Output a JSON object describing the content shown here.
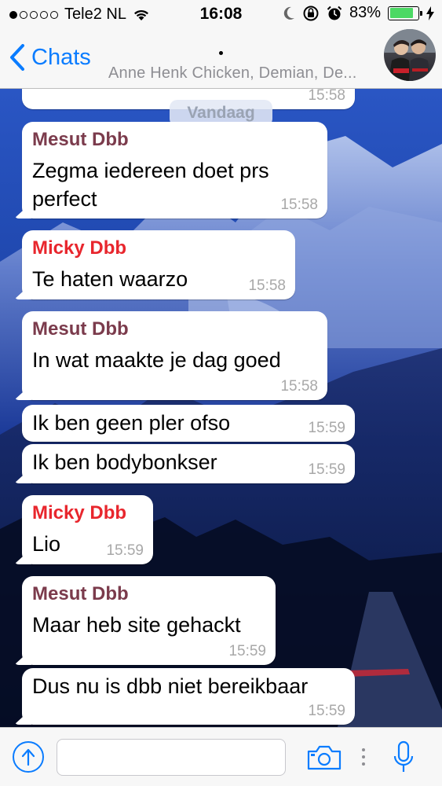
{
  "status_bar": {
    "carrier": "Tele2 NL",
    "time": "16:08",
    "battery_percent": "83%",
    "battery_level": 0.83,
    "signal_bars_filled": 1,
    "signal_bars_total": 5,
    "battery_color": "#4cd964",
    "icons": [
      "wifi-icon",
      "moon-icon",
      "orientation-lock-icon",
      "alarm-icon",
      "charging-icon"
    ]
  },
  "header": {
    "back_label": "Chats",
    "title": "",
    "subtitle": "Anne Henk Chicken, Demian, De...",
    "accent_color": "#0a7cff"
  },
  "chat": {
    "date_label": "Vandaag",
    "messages": [
      {
        "sender": "",
        "text": "",
        "time": "15:58"
      },
      {
        "sender": "Mesut Dbb",
        "sender_color": "#7b3b4c",
        "lines": [
          "Zegma iedereen doet prs",
          "perfect"
        ],
        "time": "15:58"
      },
      {
        "sender": "Micky Dbb",
        "sender_color": "#e8262d",
        "lines": [
          "Te haten waarzo"
        ],
        "time": "15:58"
      },
      {
        "sender": "Mesut Dbb",
        "sender_color": "#7b3b4c",
        "lines": [
          "In wat maakte je dag goed"
        ],
        "time": "15:58"
      },
      {
        "sender": "",
        "lines": [
          "Ik ben geen pler ofso"
        ],
        "time": "15:59"
      },
      {
        "sender": "",
        "lines": [
          "Ik ben bodybonkser"
        ],
        "time": "15:59"
      },
      {
        "sender": "Micky Dbb",
        "sender_color": "#e8262d",
        "lines": [
          "Lio"
        ],
        "time": "15:59"
      },
      {
        "sender": "Mesut Dbb",
        "sender_color": "#7b3b4c",
        "lines": [
          "Maar heb site gehackt"
        ],
        "time": "15:59"
      },
      {
        "sender": "",
        "lines": [
          "Dus nu is dbb niet bereikbaar"
        ],
        "time": "15:59"
      }
    ]
  },
  "input_bar": {
    "placeholder": "",
    "icons": [
      "share-icon",
      "camera-icon",
      "more-icon",
      "microphone-icon"
    ]
  }
}
